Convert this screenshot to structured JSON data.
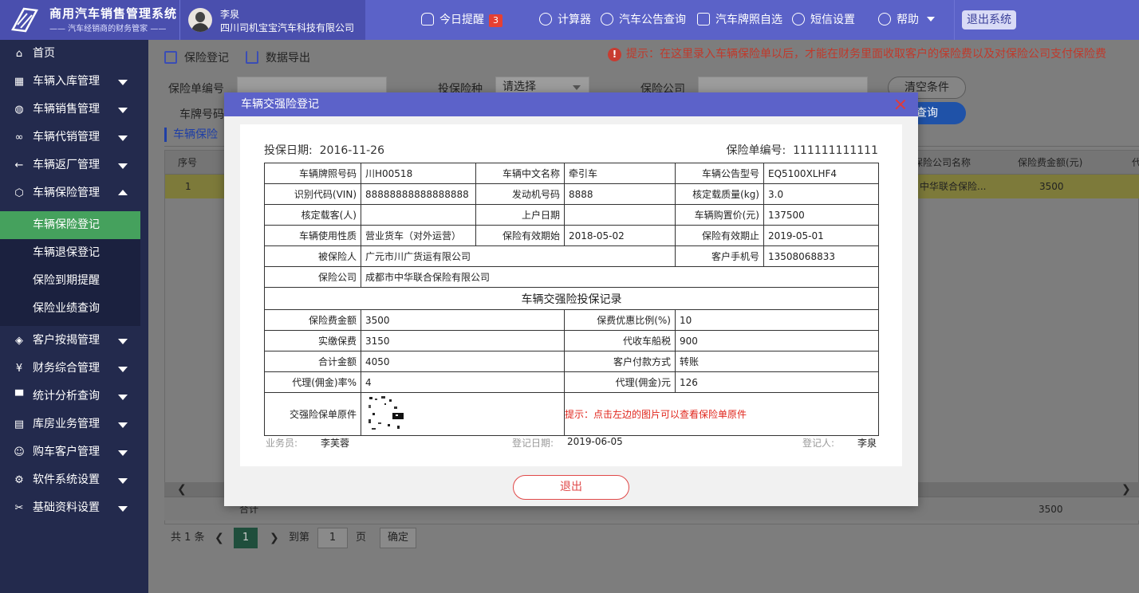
{
  "app": {
    "title": "商用汽车销售管理系统",
    "subtitle": "—— 汽车经销商的财务管家 ——"
  },
  "user": {
    "name": "李泉",
    "company": "四川司机宝宝汽车科技有限公司"
  },
  "topnav": {
    "reminder_label": "今日提醒",
    "reminder_count": "3",
    "calculator": "计算器",
    "notice_query": "汽车公告查询",
    "plate_select": "汽车牌照自选",
    "sms_settings": "短信设置",
    "help": "帮助",
    "logout": "退出系统"
  },
  "sidebar": {
    "items": [
      {
        "label": "首页",
        "icon": "home-icon"
      },
      {
        "label": "车辆入库管理",
        "icon": "grid-icon"
      },
      {
        "label": "车辆销售管理",
        "icon": "globe-icon"
      },
      {
        "label": "车辆代销管理",
        "icon": "infinity-icon"
      },
      {
        "label": "车辆返厂管理",
        "icon": "arrow-left-icon"
      },
      {
        "label": "车辆保险管理",
        "icon": "cube-icon"
      },
      {
        "label": "客户按揭管理",
        "icon": "stack-icon"
      },
      {
        "label": "财务综合管理",
        "icon": "yen-icon"
      },
      {
        "label": "统计分析查询",
        "icon": "monitor-icon"
      },
      {
        "label": "库房业务管理",
        "icon": "warehouse-icon"
      },
      {
        "label": "购车客户管理",
        "icon": "user-icon"
      },
      {
        "label": "软件系统设置",
        "icon": "gear-icon"
      },
      {
        "label": "基础资料设置",
        "icon": "tools-icon"
      }
    ],
    "subitems": [
      {
        "label": "车辆保险登记"
      },
      {
        "label": "车辆退保登记"
      },
      {
        "label": "保险到期提醒"
      },
      {
        "label": "保险业绩查询"
      }
    ]
  },
  "toolbar": {
    "register": "保险登记",
    "export": "数据导出",
    "hint": "提示：在这里录入车辆保险单以后，才能在财务里面收取客户的保险费以及对保险公司支付保险费"
  },
  "filters": {
    "policy_no_label": "保险单编号",
    "insurance_type_label": "投保险种",
    "insurance_type_value": "请选择",
    "company_label": "保险公司",
    "plate_label": "车牌号码",
    "clear": "清空条件",
    "query": "查询"
  },
  "list": {
    "tab": "车辆保险",
    "columns": [
      "序号",
      "保险公司名称",
      "保险费金额(元)",
      "代"
    ],
    "rows": [
      {
        "index": "1",
        "company": "中华联合保险...",
        "amount": "3500"
      }
    ],
    "footer_label": "合计",
    "footer_amount": "3500"
  },
  "pager": {
    "total": "共 1 条",
    "current": "1",
    "goto_label": "到第",
    "goto_value": "1",
    "page_unit": "页",
    "confirm": "确定"
  },
  "modal": {
    "title": "车辆交强险登记",
    "insure_date_label": "投保日期:",
    "insure_date": "2016-11-26",
    "policy_no_label": "保险单编号:",
    "policy_no": "111111111111",
    "fields": {
      "plate_label": "车辆牌照号码",
      "plate": "川H00518",
      "cn_name_label": "车辆中文名称",
      "cn_name": "牵引车",
      "model_label": "车辆公告型号",
      "model": "EQ5100XLHF4",
      "vin_label": "识别代码(VIN)",
      "vin": "88888888888888888",
      "engine_label": "发动机号码",
      "engine": "8888",
      "load_label": "核定载质量(kg)",
      "load": "3.0",
      "seats_label": "核定载客(人)",
      "seats": "",
      "reg_date_label": "上户日期",
      "reg_date": "",
      "price_label": "车辆购置价(元)",
      "price": "137500",
      "usage_label": "车辆使用性质",
      "usage": "营业货车（对外运营）",
      "start_label": "保险有效期始",
      "start": "2018-05-02",
      "end_label": "保险有效期止",
      "end": "2019-05-01",
      "insured_label": "被保险人",
      "insured": "广元市川广货运有限公司",
      "phone_label": "客户手机号",
      "phone": "13508068833",
      "company_label": "保险公司",
      "company": "成都市中华联合保险有限公司"
    },
    "record_title": "车辆交强险投保记录",
    "record": {
      "premium_label": "保险费金额",
      "premium": "3500",
      "discount_label": "保费优惠比例(%)",
      "discount": "10",
      "paid_label": "实缴保费",
      "paid": "3150",
      "tax_label": "代收车船税",
      "tax": "900",
      "total_label": "合计金额",
      "total": "4050",
      "pay_method_label": "客户付款方式",
      "pay_method": "转账",
      "commission_rate_label": "代理(佣金)率%",
      "commission_rate": "4",
      "commission_label": "代理(佣金)元",
      "commission": "126",
      "original_label": "交强险保单原件",
      "original_hint": "提示：点击左边的图片可以查看保险单原件"
    },
    "salesman_label": "业务员:",
    "salesman": "李芙蓉",
    "reg_date_label": "登记日期:",
    "reg_date": "2019-06-05",
    "registrar_label": "登记人:",
    "registrar": "李泉",
    "exit": "退出"
  },
  "colors": {
    "topbar": "#5b62c8",
    "sidebar": "#232a4d",
    "active_menu": "#45a15d",
    "modal_header": "#5c62c9",
    "danger": "#e04848"
  }
}
